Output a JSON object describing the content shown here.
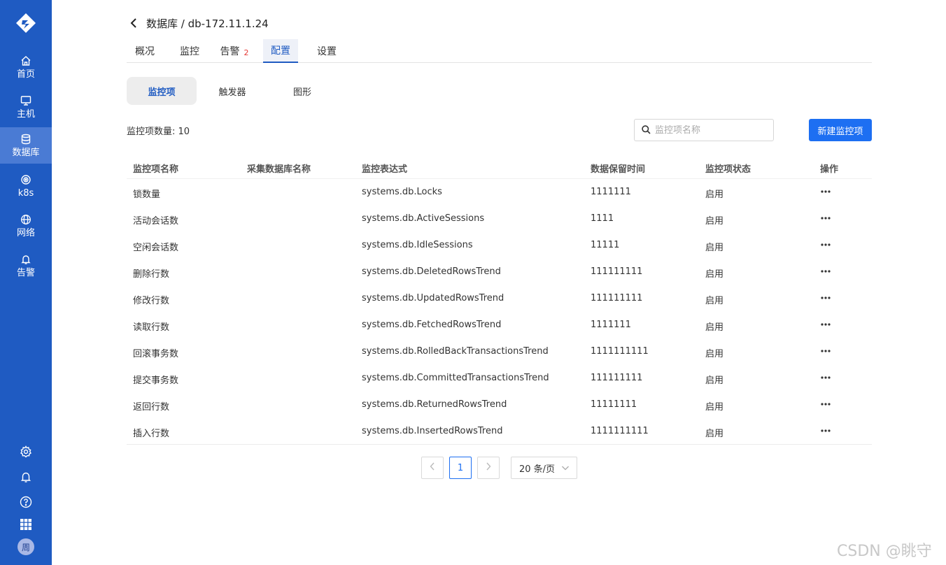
{
  "sidebar": {
    "items": [
      {
        "label": "首页",
        "icon": "home-icon"
      },
      {
        "label": "主机",
        "icon": "monitor-icon"
      },
      {
        "label": "数据库",
        "icon": "database-icon",
        "active": true
      },
      {
        "label": "k8s",
        "icon": "k8s-icon"
      },
      {
        "label": "网络",
        "icon": "globe-icon"
      },
      {
        "label": "告警",
        "icon": "bell-icon"
      }
    ],
    "bottom_icons": [
      "settings-icon",
      "notification-icon",
      "help-icon",
      "apps-grid-icon"
    ],
    "avatar_text": "周",
    "accent_color": "#1f5bc2"
  },
  "header": {
    "breadcrumb": "数据库 / db-172.11.1.24"
  },
  "tabs": [
    {
      "label": "概况"
    },
    {
      "label": "监控"
    },
    {
      "label": "告警",
      "badge": "2"
    },
    {
      "label": "配置",
      "active": true
    },
    {
      "label": "设置"
    }
  ],
  "subtabs": [
    {
      "label": "监控项",
      "active": true
    },
    {
      "label": "触发器"
    },
    {
      "label": "图形"
    }
  ],
  "summary": {
    "count_label": "监控项数量: 10"
  },
  "search": {
    "placeholder": "监控项名称"
  },
  "actions": {
    "new_button": "新建监控项"
  },
  "table": {
    "columns": [
      "监控项名称",
      "采集数据库名称",
      "监控表达式",
      "数据保留时间",
      "监控项状态",
      "操作"
    ],
    "rows": [
      {
        "name": "锁数量",
        "db": "",
        "expr": "systems.db.Locks",
        "retention": "1111111",
        "status": "启用"
      },
      {
        "name": "活动会话数",
        "db": "",
        "expr": "systems.db.ActiveSessions",
        "retention": "1111",
        "status": "启用"
      },
      {
        "name": "空闲会话数",
        "db": "",
        "expr": "systems.db.IdleSessions",
        "retention": "11111",
        "status": "启用"
      },
      {
        "name": "删除行数",
        "db": "",
        "expr": "systems.db.DeletedRowsTrend",
        "retention": "111111111",
        "status": "启用"
      },
      {
        "name": "修改行数",
        "db": "",
        "expr": "systems.db.UpdatedRowsTrend",
        "retention": "111111111",
        "status": "启用"
      },
      {
        "name": "读取行数",
        "db": "",
        "expr": "systems.db.FetchedRowsTrend",
        "retention": "1111111",
        "status": "启用"
      },
      {
        "name": "回滚事务数",
        "db": "",
        "expr": "systems.db.RolledBackTransactionsTrend",
        "retention": "1111111111",
        "status": "启用"
      },
      {
        "name": "提交事务数",
        "db": "",
        "expr": "systems.db.CommittedTransactionsTrend",
        "retention": "111111111",
        "status": "启用"
      },
      {
        "name": "返回行数",
        "db": "",
        "expr": "systems.db.ReturnedRowsTrend",
        "retention": "11111111",
        "status": "启用"
      },
      {
        "name": "插入行数",
        "db": "",
        "expr": "systems.db.InsertedRowsTrend",
        "retention": "1111111111",
        "status": "启用"
      }
    ]
  },
  "pagination": {
    "current_page": "1",
    "page_size": "20 条/页"
  },
  "watermark": "CSDN @眺守"
}
